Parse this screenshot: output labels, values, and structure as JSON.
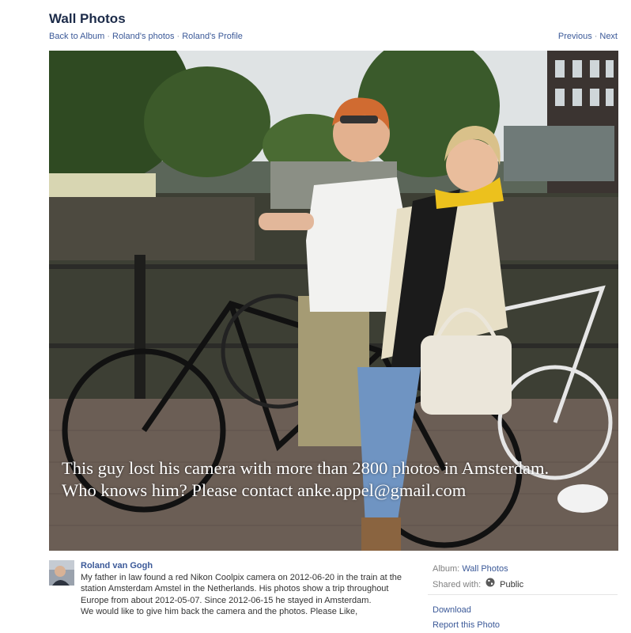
{
  "header": {
    "title": "Wall Photos",
    "nav": {
      "back": "Back to Album",
      "photos": "Roland's photos",
      "profile": "Roland's Profile",
      "separator": "·",
      "previous": "Previous",
      "next": "Next"
    }
  },
  "photo": {
    "caption_line1": "This guy lost his camera with more than 2800 photos in Amsterdam.",
    "caption_line2": "Who knows him? Please contact anke.appel@gmail.com"
  },
  "post": {
    "author": "Roland van Gogh",
    "description_line1": "My father in law found a red Nikon Coolpix camera on 2012-06-20 in the train at the station Amsterdam Amstel in the Netherlands. His photos show a trip throughout Europe from about 2012-05-07. Since 2012-06-15 he stayed in Amsterdam.",
    "description_line2": "We would like to give him back the camera and the photos. Please Like,"
  },
  "sidebar": {
    "album_label": "Album:",
    "album_value": "Wall Photos",
    "shared_label": "Shared with:",
    "shared_value": "Public",
    "shared_icon": "globe-icon",
    "download": "Download",
    "report": "Report this Photo"
  },
  "colors": {
    "link": "#3b5998",
    "title": "#1c2b49"
  }
}
